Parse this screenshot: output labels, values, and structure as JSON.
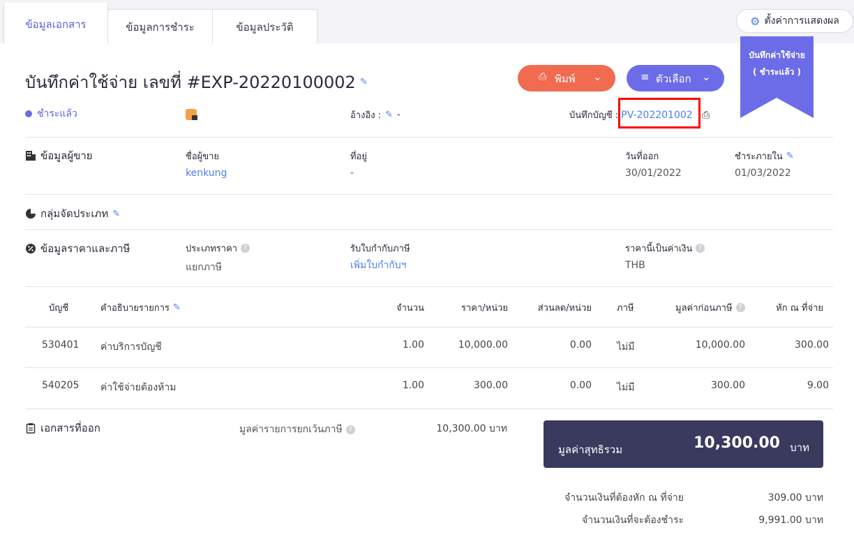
{
  "tabs": [
    "ข้อมูลเอกสาร",
    "ข้อมูลการชำระ",
    "ข้อมูลประวัติ"
  ],
  "settings_label": "ตั้งค่าการแสดงผล",
  "ribbon": {
    "title": "บันทึกค่าใช้จ่าย",
    "status": "( ชำระแล้ว )"
  },
  "document_title": "บันทึกค่าใช้จ่าย เลขที่ #EXP-20220100002",
  "buttons": {
    "print": "พิมพ์",
    "options": "ตัวเลือก"
  },
  "status": "ชำระแล้ว",
  "reference": {
    "label": "อ้างอิง :",
    "value": "-"
  },
  "journal": {
    "label": "บันทึกบัญชี :",
    "value": "PV-202201002"
  },
  "vendor": {
    "section": "ข้อมูลผู้ขาย",
    "name_label": "ชื่อผู้ขาย",
    "name": "kenkung",
    "address_label": "ที่อยู่",
    "address": "-",
    "issue_date_label": "วันที่ออก",
    "issue_date": "30/01/2022",
    "due_label": "ชำระภายใน",
    "due_date": "01/03/2022"
  },
  "category_group": "กลุ่มจัดประเภท",
  "pricing": {
    "section": "ข้อมูลราคาและภาษี",
    "price_type_label": "ประเภทราคา",
    "price_type": "แยกภาษี",
    "tax_invoice_label": "รับใบกำกับภาษี",
    "tax_invoice_action": "เพิ่มใบกำกับฯ",
    "currency_label": "ราคานี้เป็นค่าเงิน",
    "currency": "THB"
  },
  "table": {
    "headers": [
      "บัญชี",
      "คำอธิบายรายการ",
      "จำนวน",
      "ราคา/หน่วย",
      "ส่วนลด/หน่วย",
      "ภาษี",
      "มูลค่าก่อนภาษี",
      "หัก ณ ที่จ่าย"
    ],
    "rows": [
      [
        "530401",
        "ค่าบริการบัญชี",
        "1.00",
        "10,000.00",
        "0.00",
        "ไม่มี",
        "10,000.00",
        "300.00"
      ],
      [
        "540205",
        "ค่าใช้จ่ายต้องห้าม",
        "1.00",
        "300.00",
        "0.00",
        "ไม่มี",
        "300.00",
        "9.00"
      ]
    ]
  },
  "issued_docs": "เอกสารที่ออก",
  "exempt": {
    "label": "มูลค่ารายการยกเว้นภาษี",
    "value": "10,300.00 บาท"
  },
  "total": {
    "label": "มูลค่าสุทธิรวม",
    "value": "10,300.00",
    "unit": "บาท"
  },
  "withholding": {
    "label": "จำนวนเงินที่ต้องหัก ณ ที่จ่าย",
    "value": "309.00 บาท"
  },
  "to_pay": {
    "label": "จำนวนเงินที่จะต้องชำระ",
    "value": "9,991.00 บาท"
  }
}
